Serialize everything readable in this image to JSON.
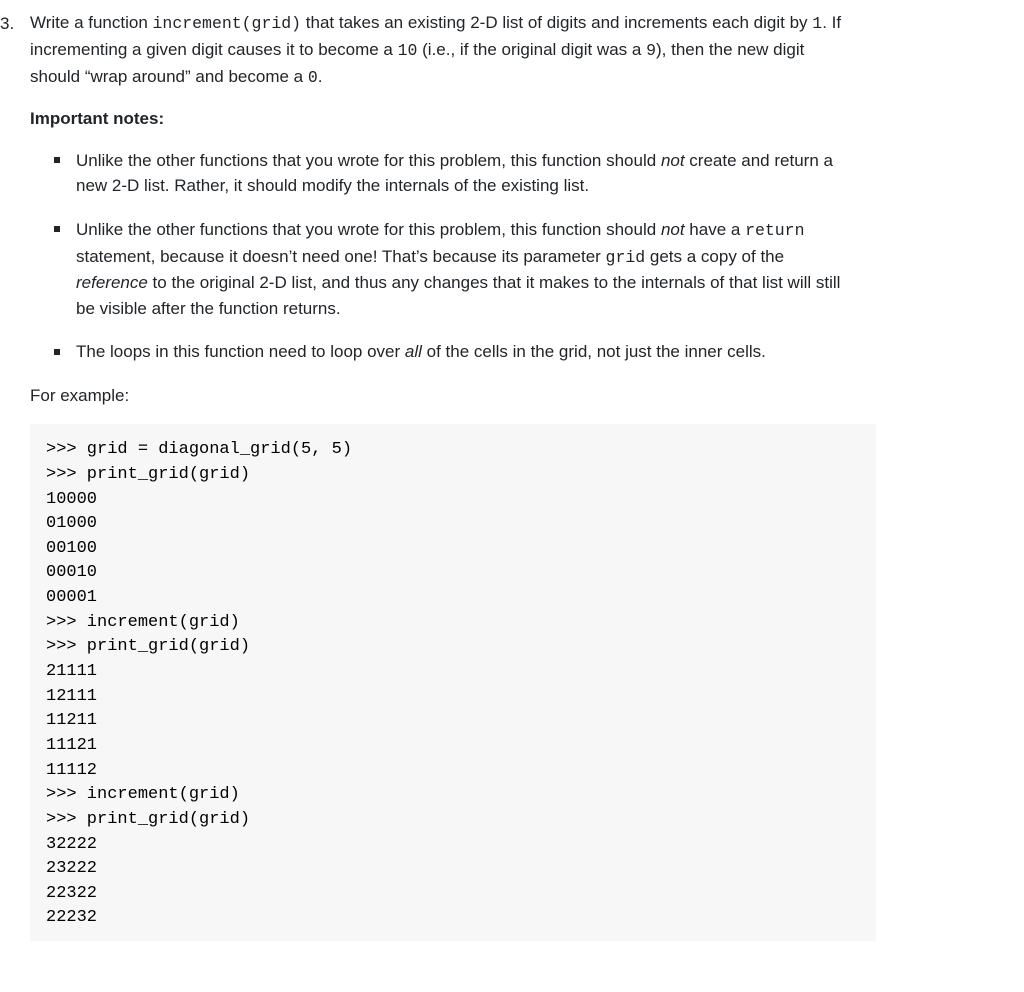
{
  "problem": {
    "number": "3.",
    "intro_a": "Write a function ",
    "intro_code1": "increment(grid)",
    "intro_b": " that takes an existing 2-D list of digits and increments each digit by ",
    "intro_code2": "1",
    "intro_c": ". If incrementing a given digit causes it to become a ",
    "intro_code3": "10",
    "intro_d": " (i.e., if the original digit was a ",
    "intro_code4": "9",
    "intro_e": "), then the new digit should “wrap around” and become a ",
    "intro_code5": "0",
    "intro_f": "."
  },
  "important_label": "Important notes:",
  "notes": [
    {
      "a": "Unlike the other functions that you wrote for this problem, this function should ",
      "not": "not",
      "b": " create and return a new 2-D list. Rather, it should modify the internals of the existing list."
    },
    {
      "a": "Unlike the other functions that you wrote for this problem, this function should ",
      "not": "not",
      "b": " have a ",
      "code1": "return",
      "c": " statement, because it doesn’t need one! That’s because its parameter ",
      "code2": "grid",
      "d": " gets a copy of the ",
      "ref": "reference",
      "e": " to the original 2-D list, and thus any changes that it makes to the internals of that list will still be visible after the function returns."
    },
    {
      "a": "The loops in this function need to loop over ",
      "all": "all",
      "b": " of the cells in the grid, not just the inner cells."
    }
  ],
  "for_example": "For example:",
  "code": ">>> grid = diagonal_grid(5, 5)\n>>> print_grid(grid)\n10000\n01000\n00100\n00010\n00001\n>>> increment(grid)\n>>> print_grid(grid)\n21111\n12111\n11211\n11121\n11112\n>>> increment(grid)\n>>> print_grid(grid)\n32222\n23222\n22322\n22232"
}
